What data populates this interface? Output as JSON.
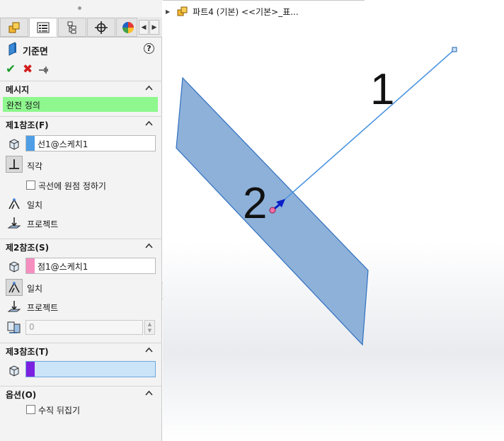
{
  "panel": {
    "tabs": [
      {
        "icon": "feature-manager-icon"
      },
      {
        "icon": "property-manager-icon"
      },
      {
        "icon": "configuration-manager-icon"
      },
      {
        "icon": "dimxpert-manager-icon"
      },
      {
        "icon": "display-manager-icon"
      }
    ],
    "title": "기준면",
    "help": "?",
    "actions": {
      "ok": "✔",
      "cancel": "✖",
      "pin": "⊣"
    },
    "message": {
      "header": "메시지",
      "text": "완전 정의"
    },
    "ref1": {
      "header": "제1참조(F)",
      "selection": "선1@스케치1",
      "color": "#4f9ee6",
      "options": [
        "직각"
      ],
      "checkbox": "곡선에 원점 정하기",
      "more": [
        "일치",
        "프로젝트"
      ]
    },
    "ref2": {
      "header": "제2참조(S)",
      "selection": "점1@스케치1",
      "color": "#f58fc0",
      "options": [
        "일치",
        "프로젝트"
      ],
      "distance": "0"
    },
    "ref3": {
      "header": "제3참조(T)",
      "selection": "",
      "color": "#7b22e0"
    },
    "options": {
      "header": "옵션(O)",
      "checkbox": "수직 뒤집기"
    }
  },
  "viewport": {
    "tree_label": "파트4 (기본) <<기본>_표...",
    "annotations": [
      "1",
      "2"
    ],
    "colors": {
      "plane_fill": "#8eb1d9",
      "plane_edge": "#2f6fc0",
      "line": "#4b95e0",
      "point": "#f070a8",
      "arrow": "#0a1fc8"
    }
  }
}
